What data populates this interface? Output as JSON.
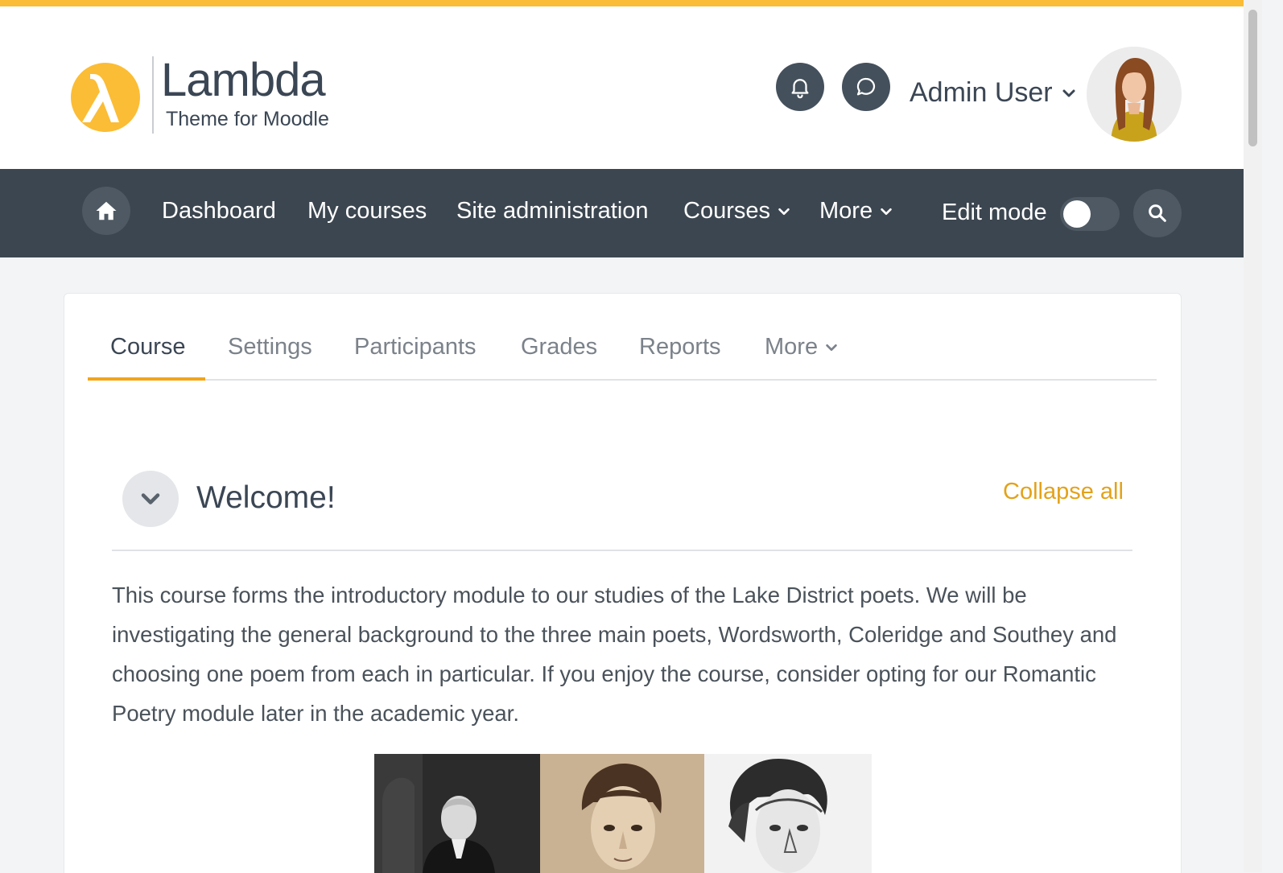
{
  "header": {
    "logo_title": "Lambda",
    "logo_subtitle": "Theme for Moodle",
    "user_name": "Admin User"
  },
  "navbar": {
    "items": [
      {
        "label": "Dashboard"
      },
      {
        "label": "My courses"
      },
      {
        "label": "Site administration"
      },
      {
        "label": "Courses"
      },
      {
        "label": "More"
      }
    ],
    "edit_mode_label": "Edit mode",
    "edit_mode_on": false
  },
  "course_tabs": [
    {
      "label": "Course",
      "active": true
    },
    {
      "label": "Settings"
    },
    {
      "label": "Participants"
    },
    {
      "label": "Grades"
    },
    {
      "label": "Reports"
    },
    {
      "label": "More"
    }
  ],
  "section": {
    "title": "Welcome!",
    "collapse_all": "Collapse all",
    "summary": "This course forms the introductory module to our studies of the Lake District poets. We will be investigating the  general background to the three main poets, Wordsworth, Coleridge and Southey and choosing one poem from each in particular. If you enjoy the course, consider opting for our Romantic Poetry module later in the academic year."
  },
  "colors": {
    "accent": "#fbbd35",
    "navbar_bg": "#3c4650",
    "link": "#e3a21a"
  },
  "icons": [
    "bell-icon",
    "chat-icon",
    "chevron-down-icon",
    "home-icon",
    "search-icon"
  ]
}
